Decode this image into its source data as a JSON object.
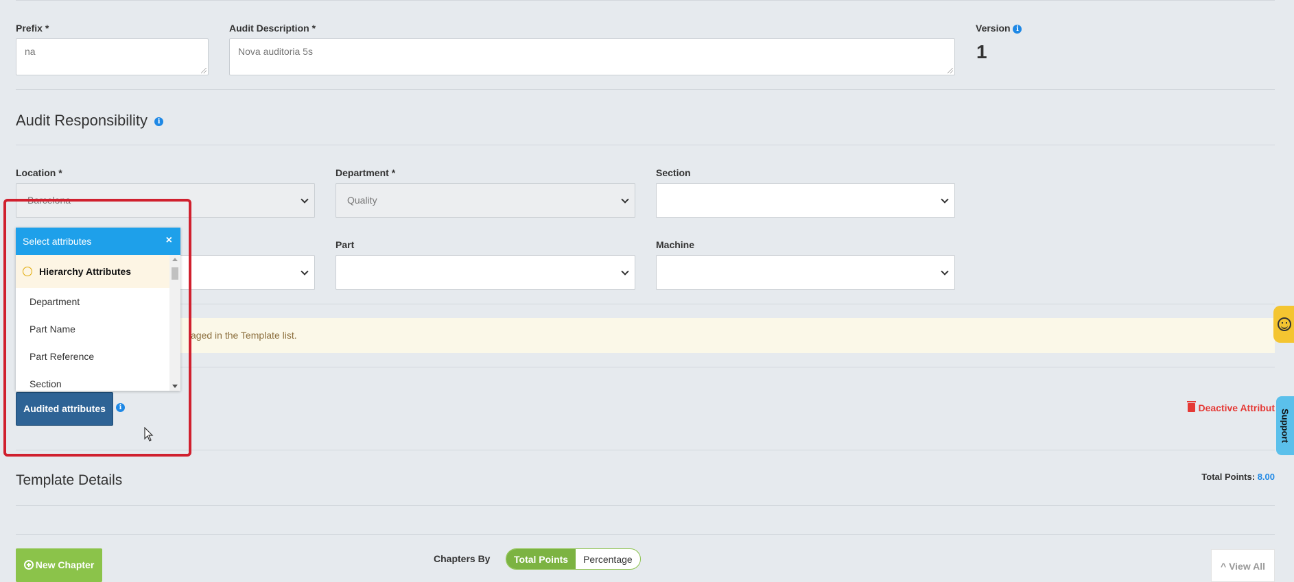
{
  "header": {
    "prefix_label": "Prefix",
    "prefix_value": "na",
    "description_label": "Audit Description",
    "description_value": "Nova auditoria 5s",
    "version_label": "Version",
    "version_value": "1",
    "required_mark": "*"
  },
  "responsibility": {
    "title": "Audit Responsibility",
    "location_label": "Location",
    "location_value": "Barcelona",
    "department_label": "Department",
    "department_value": "Quality",
    "section_label": "Section",
    "section_value": "",
    "part_label": "Part",
    "part_value": "",
    "machine_label": "Machine",
    "machine_value": ""
  },
  "banner": {
    "text": "aged in the Template list."
  },
  "attributes_popup": {
    "title": "Select attributes",
    "close_icon": "close-icon",
    "group_label": "Hierarchy Attributes",
    "options": [
      "Department",
      "Part Name",
      "Part Reference",
      "Section"
    ]
  },
  "audited_button": "Audited attributes",
  "deactive_label": "Deactive Attribut",
  "template": {
    "title": "Template Details",
    "total_points_label": "Total Points:",
    "total_points_value": "8.00"
  },
  "footer": {
    "new_chapter": "New Chapter",
    "chapters_by": "Chapters By",
    "toggle_on": "Total Points",
    "toggle_off": "Percentage",
    "view_all": "View All"
  },
  "side": {
    "support": "Support"
  },
  "colors": {
    "accent": "#1ea0ea",
    "primary_button": "#2e6395",
    "success": "#8bc34a",
    "danger": "#e53935",
    "highlight_box": "#d0202e"
  }
}
